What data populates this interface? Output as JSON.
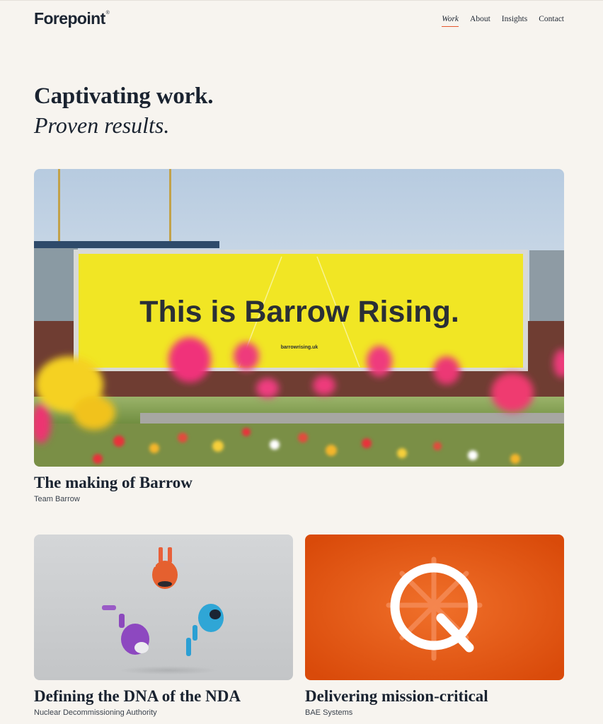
{
  "brand": {
    "name": "Forepoint",
    "mark": "®"
  },
  "nav": {
    "items": [
      {
        "label": "Work",
        "active": true
      },
      {
        "label": "About"
      },
      {
        "label": "Insights"
      },
      {
        "label": "Contact"
      }
    ]
  },
  "hero": {
    "line1": "Captivating work.",
    "line2": "Proven results."
  },
  "featured": {
    "title": "The making of Barrow",
    "client": "Team Barrow",
    "billboard_headline": "This is Barrow Rising.",
    "billboard_url": "barrowrising.uk",
    "billboard_color": "#f1e624"
  },
  "cards": [
    {
      "title": "Defining the DNA of the NDA",
      "client": "Nuclear Decommissioning Authority"
    },
    {
      "title": "Delivering mission-critical",
      "client": "BAE Systems",
      "bg_color": "#e5520c"
    }
  ],
  "colors": {
    "background": "#f7f4ef",
    "accent": "#e4572e",
    "text": "#1a2330"
  }
}
